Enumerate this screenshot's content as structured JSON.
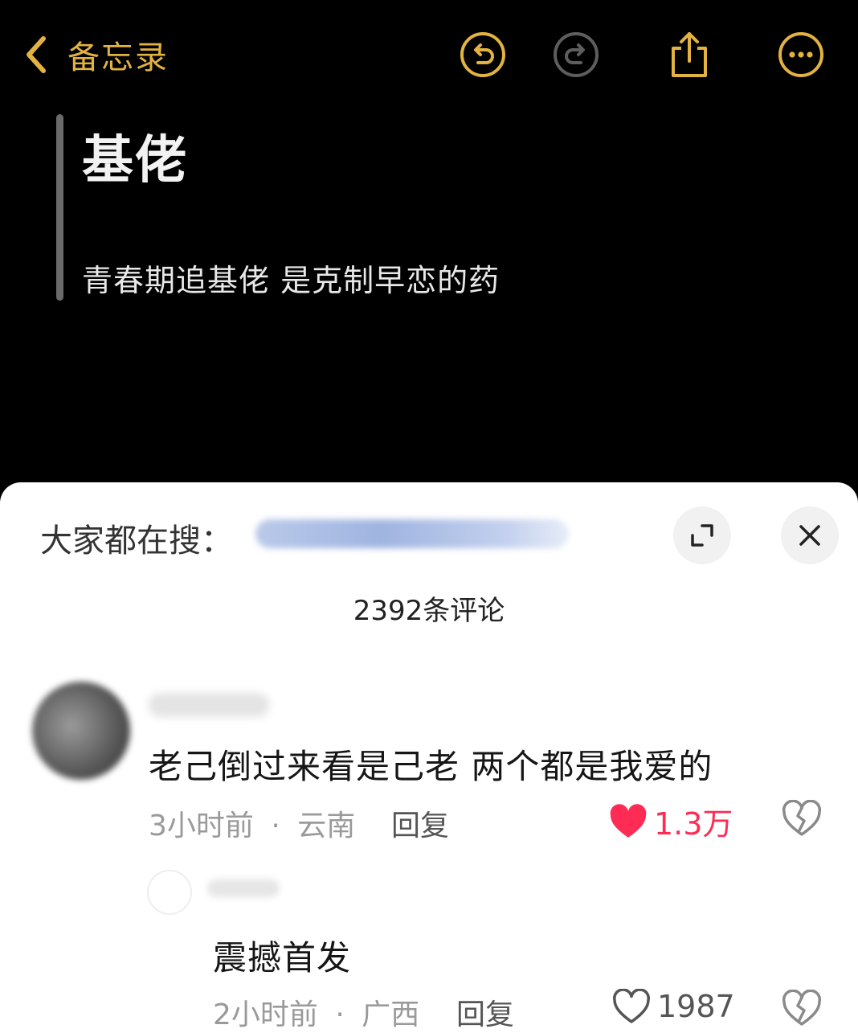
{
  "notes": {
    "back_label": "备忘录",
    "back_icon": "chevron-left-icon",
    "toolbar_icons": [
      "undo-icon",
      "redo-icon",
      "share-icon",
      "more-icon"
    ],
    "accent_color": "#e3b341",
    "title": "基佬",
    "body": "青春期追基佬 是克制早恋的药"
  },
  "sheet": {
    "search_label": "大家都在搜：",
    "expand_icon": "expand-icon",
    "close_icon": "close-icon",
    "comment_count": "2392条评论"
  },
  "comments": [
    {
      "text": "老己倒过来看是己老 两个都是我爱的",
      "time": "3小时前",
      "separator": "·",
      "location": "云南",
      "reply_label": "回复",
      "likes": "1.3万",
      "liked": true,
      "like_color": "#fe2c55"
    },
    {
      "text": "震撼首发",
      "time": "2小时前",
      "separator": "·",
      "location": "广西",
      "reply_label": "回复",
      "likes": "1987",
      "liked": false
    }
  ]
}
